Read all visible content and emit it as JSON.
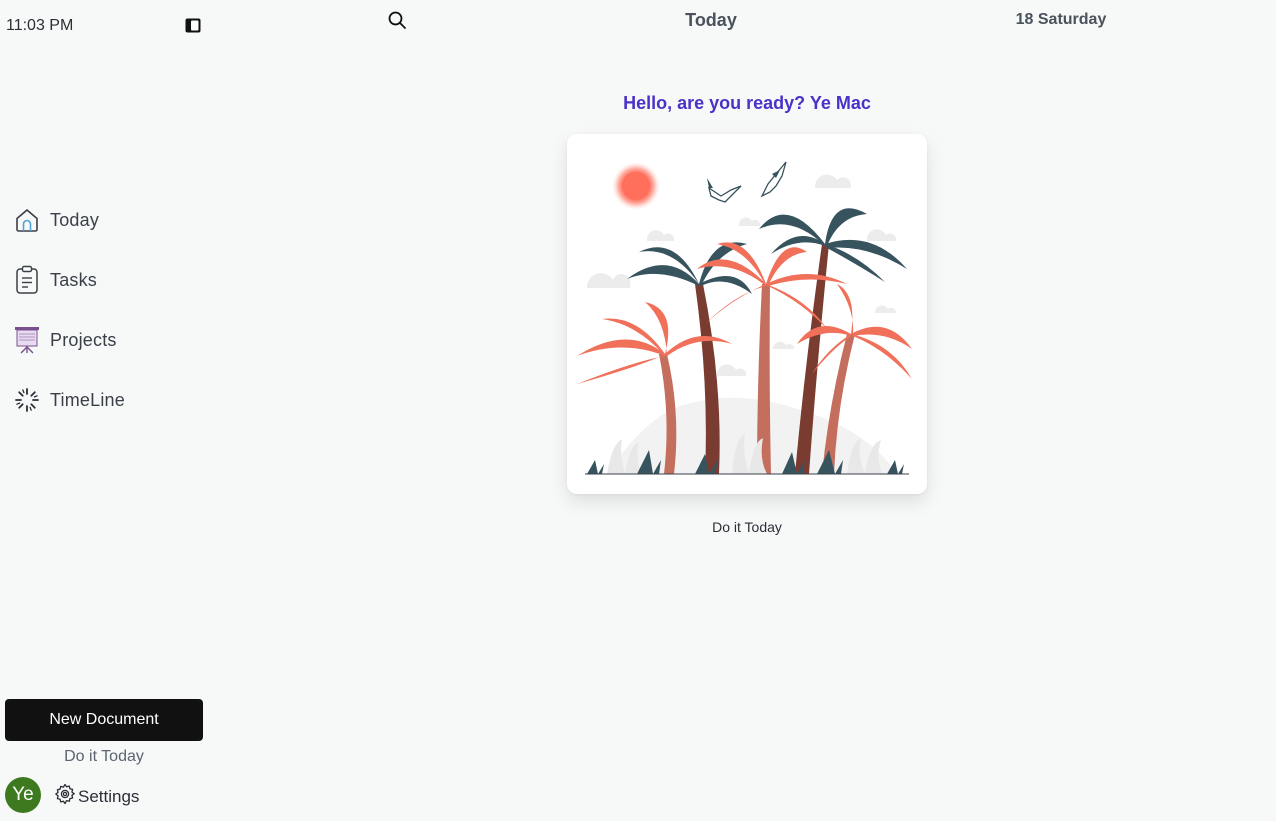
{
  "status": {
    "time": "11:03 PM"
  },
  "sidebar": {
    "items": [
      {
        "label": "Today",
        "icon": "home-icon"
      },
      {
        "label": "Tasks",
        "icon": "clipboard-icon"
      },
      {
        "label": "Projects",
        "icon": "presentation-board-icon"
      },
      {
        "label": "TimeLine",
        "icon": "loader-icon"
      }
    ],
    "new_document_label": "New Document",
    "tagline": "Do it Today",
    "avatar_initials": "Ye",
    "settings_label": "Settings"
  },
  "header": {
    "title": "Today",
    "date": "18 Saturday"
  },
  "main": {
    "greeting": "Hello, are you ready? Ye Mac",
    "caption": "Do it Today",
    "illustration": "palm-trees-illustration"
  },
  "colors": {
    "accent": "#4a32c8",
    "button_bg": "#111111",
    "avatar_bg": "#3d7a1f",
    "palm_coral": "#f0705a",
    "palm_teal": "#37535d"
  }
}
